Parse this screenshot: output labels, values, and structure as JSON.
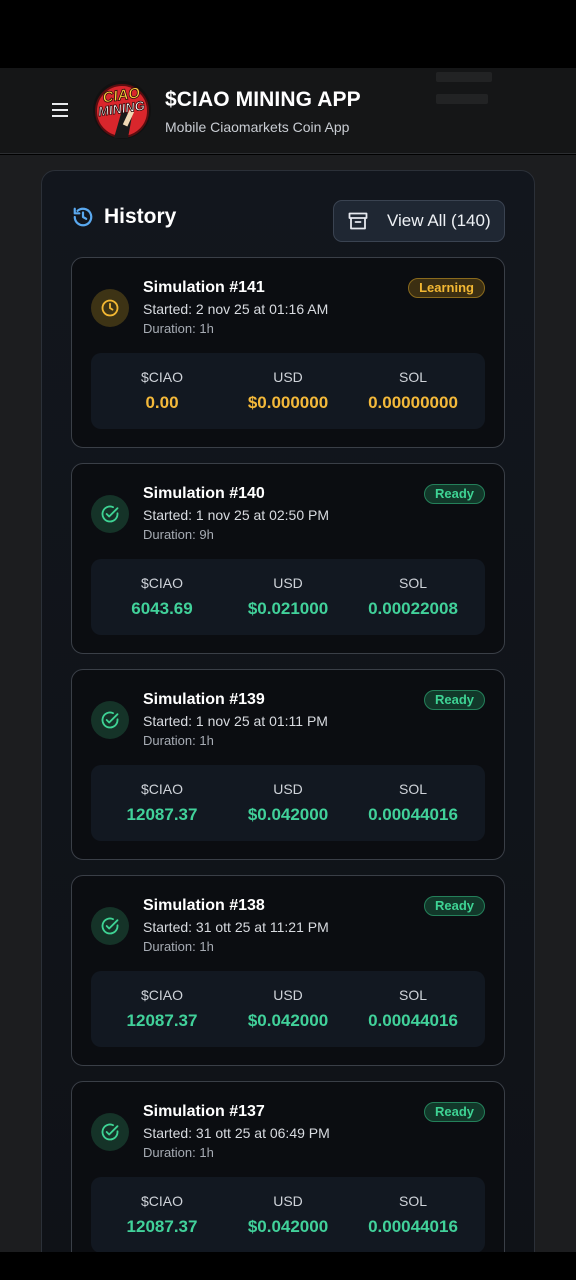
{
  "header": {
    "title": "$CIAO MINING APP",
    "subtitle": "Mobile Ciaomarkets Coin App",
    "logo_text_top": "CIAO",
    "logo_text_bottom": "MINING"
  },
  "history": {
    "title": "History",
    "view_all_label": "View All (140)"
  },
  "stat_labels": {
    "ciao": "$CIAO",
    "usd": "USD",
    "sol": "SOL"
  },
  "colors": {
    "learning": "#f4b93a",
    "ready": "#41d19a",
    "accent_blue": "#5aa9f0"
  },
  "simulations": [
    {
      "title": "Simulation #141",
      "started": "Started: 2 nov 25 at 01:16 AM",
      "duration": "Duration: 1h",
      "status": "Learning",
      "ciao": "0.00",
      "usd": "$0.000000",
      "sol": "0.00000000"
    },
    {
      "title": "Simulation #140",
      "started": "Started: 1 nov 25 at 02:50 PM",
      "duration": "Duration: 9h",
      "status": "Ready",
      "ciao": "6043.69",
      "usd": "$0.021000",
      "sol": "0.00022008"
    },
    {
      "title": "Simulation #139",
      "started": "Started: 1 nov 25 at 01:11 PM",
      "duration": "Duration: 1h",
      "status": "Ready",
      "ciao": "12087.37",
      "usd": "$0.042000",
      "sol": "0.00044016"
    },
    {
      "title": "Simulation #138",
      "started": "Started: 31 ott 25 at 11:21 PM",
      "duration": "Duration: 1h",
      "status": "Ready",
      "ciao": "12087.37",
      "usd": "$0.042000",
      "sol": "0.00044016"
    },
    {
      "title": "Simulation #137",
      "started": "Started: 31 ott 25 at 06:49 PM",
      "duration": "Duration: 1h",
      "status": "Ready",
      "ciao": "12087.37",
      "usd": "$0.042000",
      "sol": "0.00044016"
    }
  ]
}
